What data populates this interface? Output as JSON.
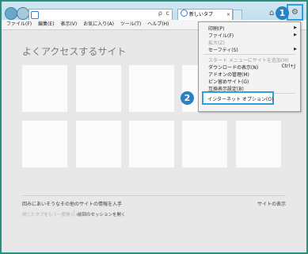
{
  "browser": {
    "tab_title": "新しいタブ",
    "tab_close": "×",
    "search_icon": "ρ",
    "refresh_icon": "c",
    "home_icon": "⌂",
    "star_icon": "☆",
    "gear_icon": "⚙"
  },
  "menubar": {
    "items": [
      "ファイル(F)",
      "編集(E)",
      "表示(V)",
      "お気に入り(A)",
      "ツール(T)",
      "ヘルプ(H)"
    ]
  },
  "newtab_page": {
    "heading": "よくアクセスするサイト",
    "tile_count": 10,
    "discover_link": "回みにあいそうなその他のサイトの情報を入手",
    "show_sites": "サイトの表示",
    "reopen_closed": "閉じたタブをもう一度開く ▾",
    "reopen_session": "前回のセッションを開く"
  },
  "markers": {
    "one": "1",
    "two": "2"
  },
  "tools_menu": {
    "items": [
      {
        "label": "印刷(P)",
        "arrow": "▶"
      },
      {
        "label": "ファイル(F)",
        "arrow": "▶"
      },
      {
        "label": "拡大(Z)",
        "arrow": ""
      },
      {
        "label": "セーフティ(S)",
        "arrow": "▶"
      },
      {
        "label": "スタート メニューにサイトを追加(M)",
        "arrow": ""
      },
      {
        "label": "ダウンロードの表示(N)",
        "shortcut": "Ctrl+J"
      },
      {
        "label": "アドオンの管理(M)",
        "arrow": ""
      },
      {
        "label": "ピン留めサイト(G)",
        "arrow": ""
      },
      {
        "label": "互換表示設定(B)",
        "arrow": ""
      }
    ],
    "internet_options": "インターネット オプション(O)"
  }
}
